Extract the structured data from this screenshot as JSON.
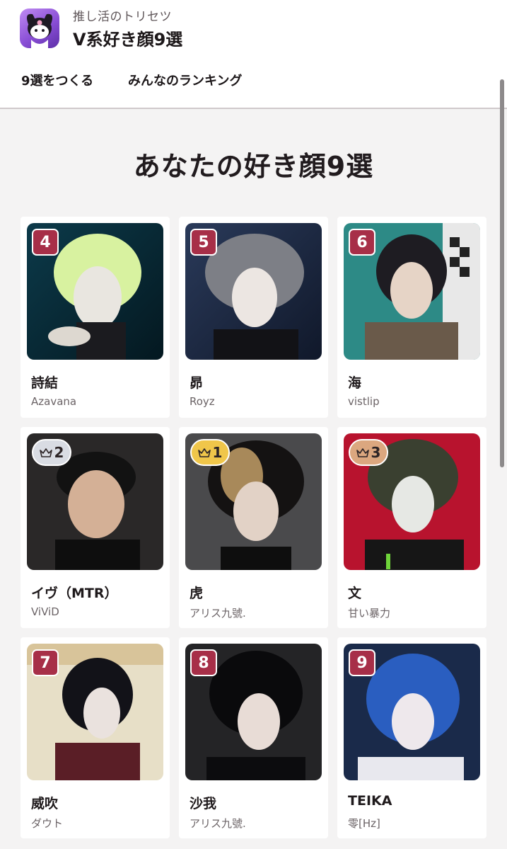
{
  "app": {
    "subtitle": "推し活のトリセツ",
    "title": "V系好き顔9選",
    "icon": "kuromi-app-icon"
  },
  "nav": {
    "create": "9選をつくる",
    "ranking": "みんなのランキング"
  },
  "heading": "あなたの好き顔9選",
  "colors": {
    "rank_badge": "#a72f48",
    "crown_gold": "#f0c64a",
    "crown_silver": "#d9dce3",
    "crown_bronze": "#dba77f"
  },
  "cards": [
    {
      "rank": "4",
      "badge": "number",
      "name": "詩結",
      "group": "Azavana"
    },
    {
      "rank": "5",
      "badge": "number",
      "name": "昴",
      "group": "Royz"
    },
    {
      "rank": "6",
      "badge": "number",
      "name": "海",
      "group": "vistlip"
    },
    {
      "rank": "2",
      "badge": "crown-silver",
      "name": "イヴ（MTR）",
      "group": "ViViD"
    },
    {
      "rank": "1",
      "badge": "crown-gold",
      "name": "虎",
      "group": "アリス九號."
    },
    {
      "rank": "3",
      "badge": "crown-bronze",
      "name": "文",
      "group": "甘い暴力"
    },
    {
      "rank": "7",
      "badge": "number",
      "name": "威吹",
      "group": "ダウト"
    },
    {
      "rank": "8",
      "badge": "number",
      "name": "沙我",
      "group": "アリス九號."
    },
    {
      "rank": "9",
      "badge": "number",
      "name": "TEIKA",
      "group": "零[Hz]"
    }
  ]
}
